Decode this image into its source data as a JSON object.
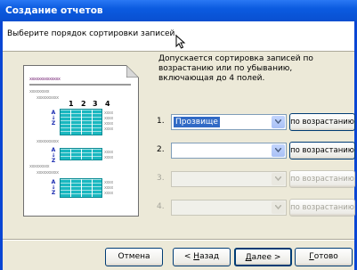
{
  "window": {
    "title": "Создание отчетов"
  },
  "header": {
    "instruction": "Выберите порядок сортировки записей."
  },
  "preview": {
    "title_dots": "xxxxxxxxxxxxxx",
    "group_dots": "xxxxxxxxx",
    "subgroup_dots": "xxxxxxxxxx",
    "column_numbers": [
      "1",
      "2",
      "3",
      "4"
    ],
    "az_label": "A\nZ"
  },
  "info_text": "Допускается сортировка записей по возрастанию или по убыванию, включающая до 4 полей.",
  "sort_rows": [
    {
      "number": "1.",
      "field": "Прозвище",
      "order": "по возрастанию",
      "enabled": true
    },
    {
      "number": "2.",
      "field": "",
      "order": "по возрастанию",
      "enabled": true
    },
    {
      "number": "3.",
      "field": "",
      "order": "по возрастанию",
      "enabled": false
    },
    {
      "number": "4.",
      "field": "",
      "order": "по возрастанию",
      "enabled": false
    }
  ],
  "buttons": {
    "cancel": "Отмена",
    "back_prefix": "< ",
    "back_hot": "Н",
    "back_rest": "азад",
    "next_hot": "Д",
    "next_rest": "алее >",
    "finish_hot": "Г",
    "finish_rest": "отово"
  },
  "colors": {
    "title_bar": "#0a4fd0",
    "preview_grid": "#1ab8c0",
    "selection": "#316ac5"
  }
}
